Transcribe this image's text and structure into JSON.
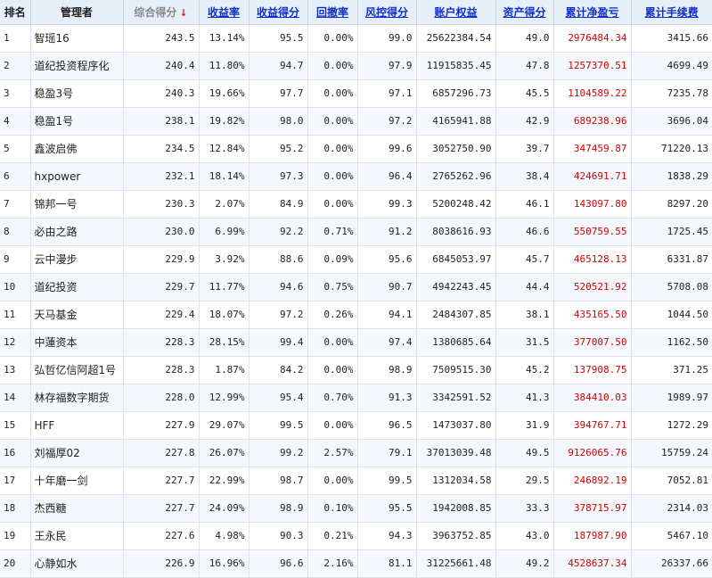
{
  "columns": [
    {
      "key": "rank",
      "label": "排名",
      "style": "plain"
    },
    {
      "key": "manager",
      "label": "管理者",
      "style": "plain"
    },
    {
      "key": "total_score",
      "label": "综合得分",
      "style": "gray",
      "sorted": true
    },
    {
      "key": "return_rate",
      "label": "收益率",
      "style": "sort"
    },
    {
      "key": "return_score",
      "label": "收益得分",
      "style": "sort"
    },
    {
      "key": "drawdown",
      "label": "回撤率",
      "style": "sort"
    },
    {
      "key": "risk_score",
      "label": "风控得分",
      "style": "sort"
    },
    {
      "key": "equity",
      "label": "账户权益",
      "style": "sort"
    },
    {
      "key": "asset_score",
      "label": "资产得分",
      "style": "sort"
    },
    {
      "key": "net_profit",
      "label": "累计净盈亏",
      "style": "sort"
    },
    {
      "key": "fees",
      "label": "累计手续费",
      "style": "sort"
    }
  ],
  "sort_arrow": "↓",
  "rows": [
    [
      "1",
      "智瑶16",
      "243.5",
      "13.14%",
      "95.5",
      "0.00%",
      "99.0",
      "25622384.54",
      "49.0",
      "2976484.34",
      "3415.66"
    ],
    [
      "2",
      "道纪投资程序化",
      "240.4",
      "11.80%",
      "94.7",
      "0.00%",
      "97.9",
      "11915835.45",
      "47.8",
      "1257370.51",
      "4699.49"
    ],
    [
      "3",
      "稳盈3号",
      "240.3",
      "19.66%",
      "97.7",
      "0.00%",
      "97.1",
      "6857296.73",
      "45.5",
      "1104589.22",
      "7235.78"
    ],
    [
      "4",
      "稳盈1号",
      "238.1",
      "19.82%",
      "98.0",
      "0.00%",
      "97.2",
      "4165941.88",
      "42.9",
      "689238.96",
      "3696.04"
    ],
    [
      "5",
      "鑫波启佛",
      "234.5",
      "12.84%",
      "95.2",
      "0.00%",
      "99.6",
      "3052750.90",
      "39.7",
      "347459.87",
      "71220.13"
    ],
    [
      "6",
      "hxpower",
      "232.1",
      "18.14%",
      "97.3",
      "0.00%",
      "96.4",
      "2765262.96",
      "38.4",
      "424691.71",
      "1838.29"
    ],
    [
      "7",
      "锦邦一号",
      "230.3",
      "2.07%",
      "84.9",
      "0.00%",
      "99.3",
      "5200248.42",
      "46.1",
      "143097.80",
      "8297.20"
    ],
    [
      "8",
      "必由之路",
      "230.0",
      "6.99%",
      "92.2",
      "0.71%",
      "91.2",
      "8038616.93",
      "46.6",
      "550759.55",
      "1725.45"
    ],
    [
      "9",
      "云中漫步",
      "229.9",
      "3.92%",
      "88.6",
      "0.09%",
      "95.6",
      "6845053.97",
      "45.7",
      "465128.13",
      "6331.87"
    ],
    [
      "10",
      "道纪投资",
      "229.7",
      "11.77%",
      "94.6",
      "0.75%",
      "90.7",
      "4942243.45",
      "44.4",
      "520521.92",
      "5708.08"
    ],
    [
      "11",
      "天马基金",
      "229.4",
      "18.07%",
      "97.2",
      "0.26%",
      "94.1",
      "2484307.85",
      "38.1",
      "435165.50",
      "1044.50"
    ],
    [
      "12",
      "中蓮资本",
      "228.3",
      "28.15%",
      "99.4",
      "0.00%",
      "97.4",
      "1380685.64",
      "31.5",
      "377007.50",
      "1162.50"
    ],
    [
      "13",
      "弘哲亿信阿超1号",
      "228.3",
      "1.87%",
      "84.2",
      "0.00%",
      "98.9",
      "7509515.30",
      "45.2",
      "137908.75",
      "371.25"
    ],
    [
      "14",
      "林存福数字期货",
      "228.0",
      "12.99%",
      "95.4",
      "0.70%",
      "91.3",
      "3342591.52",
      "41.3",
      "384410.03",
      "1989.97"
    ],
    [
      "15",
      "HFF",
      "227.9",
      "29.07%",
      "99.5",
      "0.00%",
      "96.5",
      "1473037.80",
      "31.9",
      "394767.71",
      "1272.29"
    ],
    [
      "16",
      "刘福厚02",
      "227.8",
      "26.07%",
      "99.2",
      "2.57%",
      "79.1",
      "37013039.48",
      "49.5",
      "9126065.76",
      "15759.24"
    ],
    [
      "17",
      "十年磨一剑",
      "227.7",
      "22.99%",
      "98.7",
      "0.00%",
      "99.5",
      "1312034.58",
      "29.5",
      "246892.19",
      "7052.81"
    ],
    [
      "18",
      "杰西糖",
      "227.7",
      "24.09%",
      "98.9",
      "0.10%",
      "95.5",
      "1942008.85",
      "33.3",
      "378715.97",
      "2314.03"
    ],
    [
      "19",
      "王永民",
      "227.6",
      "4.98%",
      "90.3",
      "0.21%",
      "94.3",
      "3963752.85",
      "43.0",
      "187987.90",
      "5467.10"
    ],
    [
      "20",
      "心静如水",
      "226.9",
      "16.96%",
      "96.6",
      "2.16%",
      "81.1",
      "31225661.48",
      "49.2",
      "4528637.34",
      "26337.66"
    ]
  ]
}
